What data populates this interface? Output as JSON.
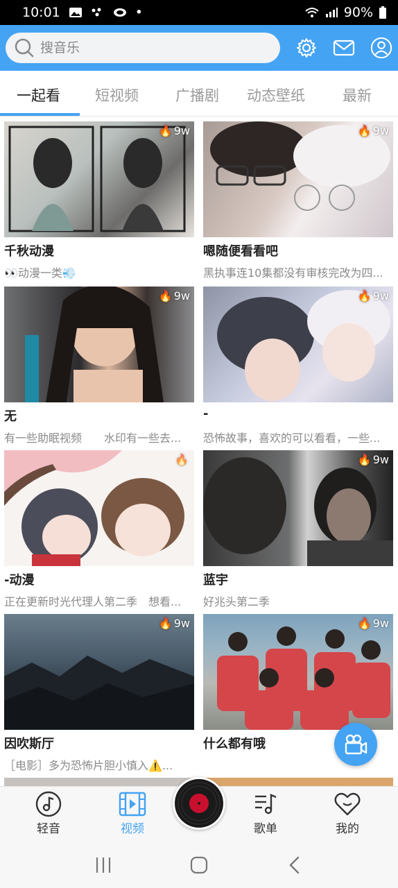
{
  "status": {
    "time": "10:01",
    "battery": "90%"
  },
  "search": {
    "placeholder": "搜音乐"
  },
  "tabs": [
    "一起看",
    "短视频",
    "广播剧",
    "动态壁纸",
    "最新"
  ],
  "cards": [
    {
      "title": "千秋动漫",
      "subtitle": "👀动漫一类💨",
      "hot": "9w"
    },
    {
      "title": "嗯随便看看吧",
      "subtitle": "黑执事连10集都没有审核完改为四...",
      "hot": "9w"
    },
    {
      "title": "无",
      "subtitle": "有一些助眠视频　　水印有一些去...",
      "hot": "9w"
    },
    {
      "title": "-",
      "subtitle": "恐怖故事，喜欢的可以看看，一些...",
      "hot": "9w"
    },
    {
      "title": "-动漫",
      "subtitle": "正在更新时光代理人第二季　想看...",
      "hot": ""
    },
    {
      "title": "蓝宇",
      "subtitle": "好兆头第二季",
      "hot": "9w"
    },
    {
      "title": "因吹斯厅",
      "subtitle": "［电影］多为恐怖片胆小慎入⚠️...",
      "hot": "9w"
    },
    {
      "title": "什么都有哦",
      "subtitle": "",
      "hot": "9w"
    }
  ],
  "bottom_nav": [
    "轻音",
    "视频",
    "歌单",
    "我的"
  ],
  "colors": {
    "accent": "#44a3f2",
    "record": "#c8102e"
  }
}
